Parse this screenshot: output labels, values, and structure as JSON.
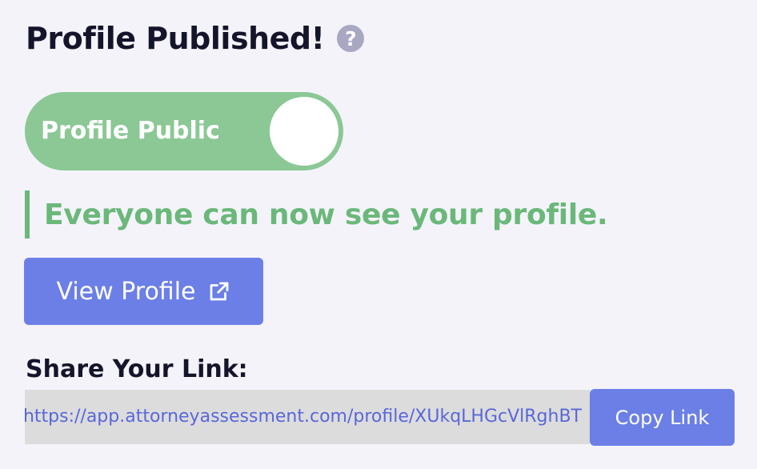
{
  "header": {
    "title": "Profile Published!",
    "help_icon": "question-circle-icon",
    "help_glyph": "?"
  },
  "visibility_toggle": {
    "label": "Profile Public",
    "state": "on",
    "color": "#8bc895"
  },
  "status": {
    "message": "Everyone can now see your profile.",
    "color": "#6bb87a"
  },
  "view_profile": {
    "label": "View Profile",
    "icon": "external-link-icon"
  },
  "share": {
    "label": "Share Your Link:",
    "link_value": "https://app.attorneyassessment.com/profile/XUkqLHGcVlRghBT",
    "copy_label": "Copy Link"
  },
  "colors": {
    "background": "#f4f3fa",
    "primary_button": "#6b7fe6",
    "text": "#14142b",
    "link_text": "#5a67d8",
    "input_bg": "#dcdcdc"
  }
}
